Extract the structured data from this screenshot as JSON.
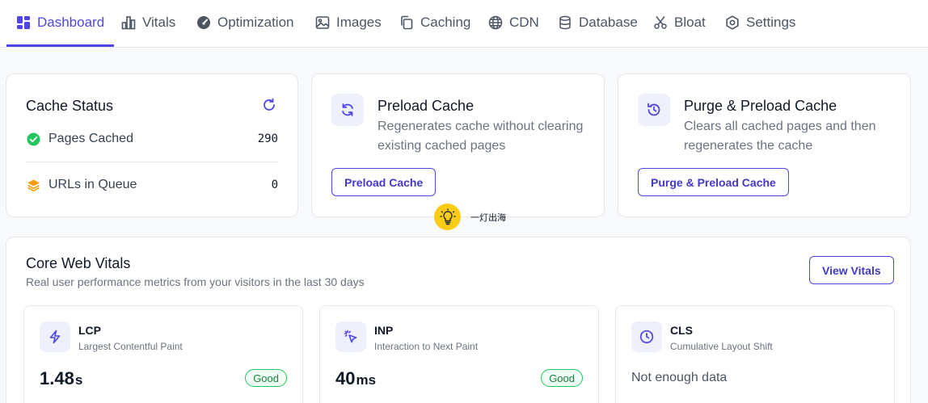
{
  "nav": {
    "tabs": [
      {
        "label": "Dashboard",
        "icon": "dashboard-icon"
      },
      {
        "label": "Vitals",
        "icon": "bar-chart-icon"
      },
      {
        "label": "Optimization",
        "icon": "gauge-icon"
      },
      {
        "label": "Images",
        "icon": "image-icon"
      },
      {
        "label": "Caching",
        "icon": "copy-icon"
      },
      {
        "label": "CDN",
        "icon": "globe-icon"
      },
      {
        "label": "Database",
        "icon": "database-icon"
      },
      {
        "label": "Bloat",
        "icon": "scissors-icon"
      },
      {
        "label": "Settings",
        "icon": "settings-icon"
      }
    ],
    "active_index": 0
  },
  "cache_status": {
    "title": "Cache Status",
    "rows": [
      {
        "label": "Pages Cached",
        "value": "290"
      },
      {
        "label": "URLs in Queue",
        "value": "0"
      }
    ]
  },
  "preload": {
    "title": "Preload Cache",
    "description": "Regenerates cache without clearing existing cached pages",
    "button": "Preload Cache"
  },
  "purge": {
    "title": "Purge & Preload Cache",
    "description": "Clears all cached pages and then regenerates the cache",
    "button": "Purge & Preload Cache"
  },
  "overlay": {
    "text": "一灯出海"
  },
  "vitals": {
    "title": "Core Web Vitals",
    "subtitle": "Real user performance metrics from your visitors in the last 30 days",
    "button": "View Vitals",
    "cards": [
      {
        "code": "LCP",
        "name": "Largest Contentful Paint",
        "value": "1.48",
        "unit": "s",
        "badge": "Good"
      },
      {
        "code": "INP",
        "name": "Interaction to Next Paint",
        "value": "40",
        "unit": "ms",
        "badge": "Good"
      },
      {
        "code": "CLS",
        "name": "Cumulative Layout Shift",
        "empty_text": "Not enough data"
      }
    ]
  },
  "colors": {
    "accent": "#4f46e5",
    "success": "#22c55e",
    "queue": "#f59e0b",
    "overlay": "#facc15"
  }
}
